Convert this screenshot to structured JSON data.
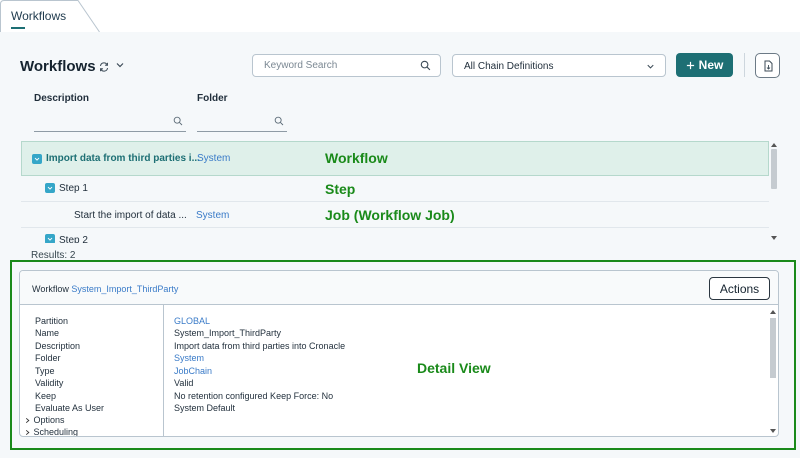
{
  "tab": {
    "label": "Workflows"
  },
  "header": {
    "title": "Workflows",
    "search_placeholder": "Keyword Search",
    "chain_select_value": "All Chain Definitions",
    "new_label": "New"
  },
  "columns": {
    "description": "Description",
    "folder": "Folder"
  },
  "grid": {
    "rows": [
      {
        "description": "Import data from third parties i...",
        "folder": "System"
      },
      {
        "description": "Step 1",
        "folder": ""
      },
      {
        "description": "Start the import of data ...",
        "folder": "System"
      },
      {
        "description": "Step 2",
        "folder": ""
      }
    ],
    "labels": {
      "workflow": "Workflow",
      "step": "Step",
      "job": "Job (Workflow Job)"
    }
  },
  "results": "Results: 2",
  "detail": {
    "prefix": "Workflow",
    "name_link": "System_Import_ThirdParty",
    "actions_label": "Actions",
    "keys": [
      "Partition",
      "Name",
      "Description",
      "Folder",
      "Type",
      "Validity",
      "Keep",
      "Evaluate As User"
    ],
    "values": [
      "GLOBAL",
      "System_Import_ThirdParty",
      "Import data from third parties into Cronacle",
      "System",
      "JobChain",
      "Valid",
      "No retention configured  Keep Force: No",
      "System Default"
    ],
    "sections": [
      "Options",
      "Scheduling"
    ],
    "label": "Detail View"
  }
}
